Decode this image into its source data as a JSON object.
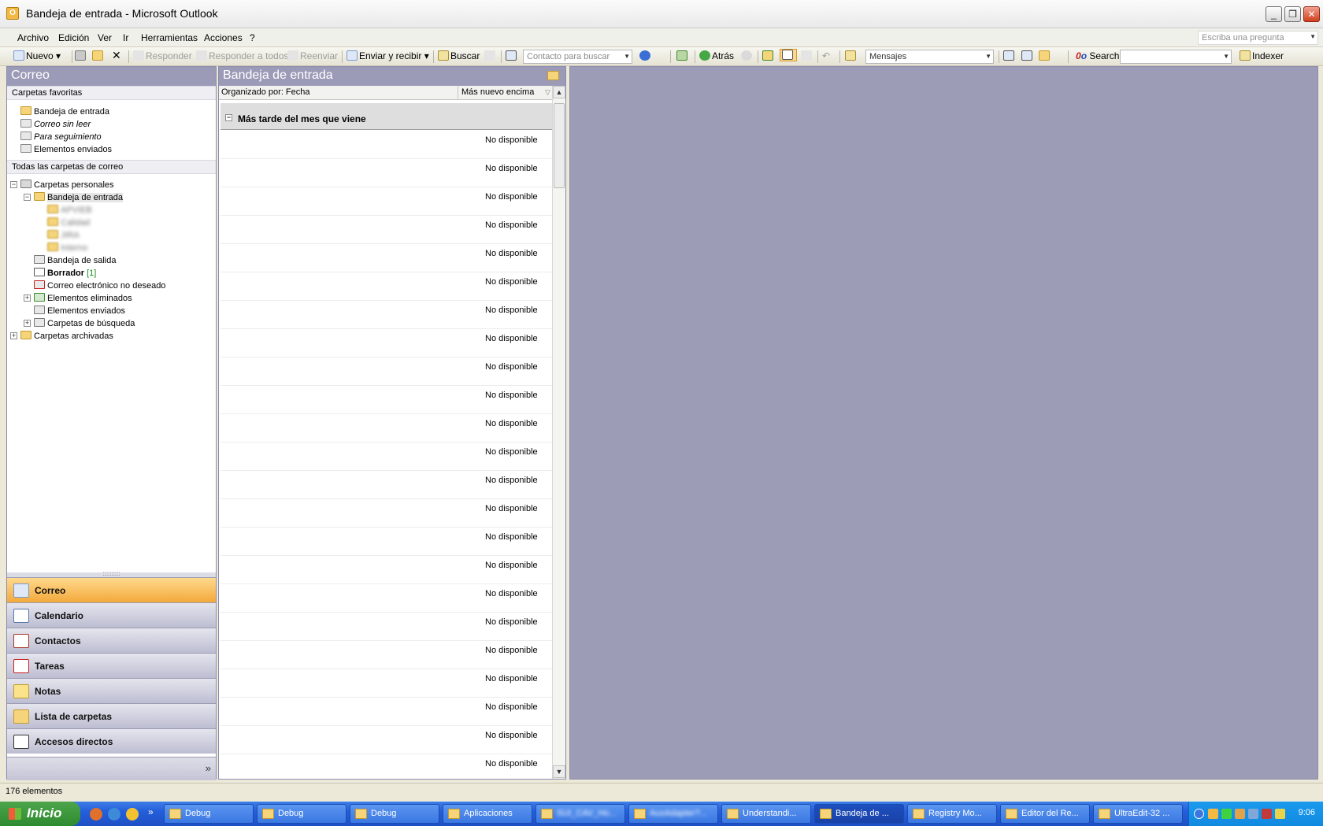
{
  "window": {
    "title": "Bandeja de entrada - Microsoft Outlook",
    "controls": {
      "minimize": "_",
      "maximize": "❐",
      "close": "✕"
    }
  },
  "menu": {
    "items": [
      "Archivo",
      "Edición",
      "Ver",
      "Ir",
      "Herramientas",
      "Acciones",
      "?"
    ],
    "help_placeholder": "Escriba una pregunta"
  },
  "toolbar": {
    "new": "Nuevo",
    "reply": "Responder",
    "reply_all": "Responder a todos",
    "forward": "Reenviar",
    "send_receive": "Enviar y recibir",
    "find": "Buscar",
    "contact_search_placeholder": "Contacto para buscar",
    "back": "Atrás",
    "view_combo": "Mensajes",
    "search": "Search",
    "search_prefix": "0",
    "indexer": "Indexer"
  },
  "nav": {
    "title": "Correo",
    "favorites_header": "Carpetas favoritas",
    "favorites": [
      {
        "label": "Bandeja de entrada",
        "style": "normal"
      },
      {
        "label": "Correo sin leer",
        "style": "italic"
      },
      {
        "label": "Para seguimiento",
        "style": "italic"
      },
      {
        "label": "Elementos enviados",
        "style": "normal"
      }
    ],
    "all_header": "Todas las carpetas de correo",
    "tree": {
      "root": "Carpetas personales",
      "inbox": "Bandeja de entrada",
      "subfolders": [
        "APVIEB",
        "Calidad",
        "JIRA",
        "Interno"
      ],
      "outbox": "Bandeja de salida",
      "drafts": "Borrador",
      "drafts_count": "[1]",
      "junk": "Correo electrónico no deseado",
      "deleted": "Elementos eliminados",
      "sent": "Elementos enviados",
      "search_folders": "Carpetas de búsqueda",
      "archive": "Carpetas archivadas"
    },
    "buttons": [
      "Correo",
      "Calendario",
      "Contactos",
      "Tareas",
      "Notas",
      "Lista de carpetas",
      "Accesos directos"
    ],
    "more": "»"
  },
  "list": {
    "title": "Bandeja de entrada",
    "arranged_by": "Organizado por: Fecha",
    "sort_order": "Más nuevo encima",
    "group": "Más tarde del mes que viene",
    "rows": [
      "No disponible",
      "No disponible",
      "No disponible",
      "No disponible",
      "No disponible",
      "No disponible",
      "No disponible",
      "No disponible",
      "No disponible",
      "No disponible",
      "No disponible",
      "No disponible",
      "No disponible",
      "No disponible",
      "No disponible",
      "No disponible",
      "No disponible",
      "No disponible",
      "No disponible",
      "No disponible",
      "No disponible",
      "No disponible",
      "No disponible"
    ]
  },
  "status": {
    "items": "176 elementos"
  },
  "taskbar": {
    "start": "Inicio",
    "items": [
      {
        "label": "Debug",
        "blurred": false
      },
      {
        "label": "Debug",
        "blurred": false
      },
      {
        "label": "Debug",
        "blurred": false
      },
      {
        "label": "Aplicaciones",
        "blurred": false
      },
      {
        "label": "SUI_CAV_Ho...",
        "blurred": true
      },
      {
        "label": "AuxAdapter?...",
        "blurred": true
      },
      {
        "label": "Understandi...",
        "blurred": false
      },
      {
        "label": "Bandeja de ...",
        "blurred": false
      },
      {
        "label": "Registry Mo...",
        "blurred": false
      },
      {
        "label": "Editor del Re...",
        "blurred": false
      },
      {
        "label": "UltraEdit-32 ...",
        "blurred": false
      }
    ],
    "active_index": 7,
    "clock": "9:06"
  },
  "colors": {
    "pane_title": "#9b9bb8",
    "reading_pane": "#9c9cb6",
    "active_nav": "#f3a93b",
    "taskbar": "#245edb"
  }
}
